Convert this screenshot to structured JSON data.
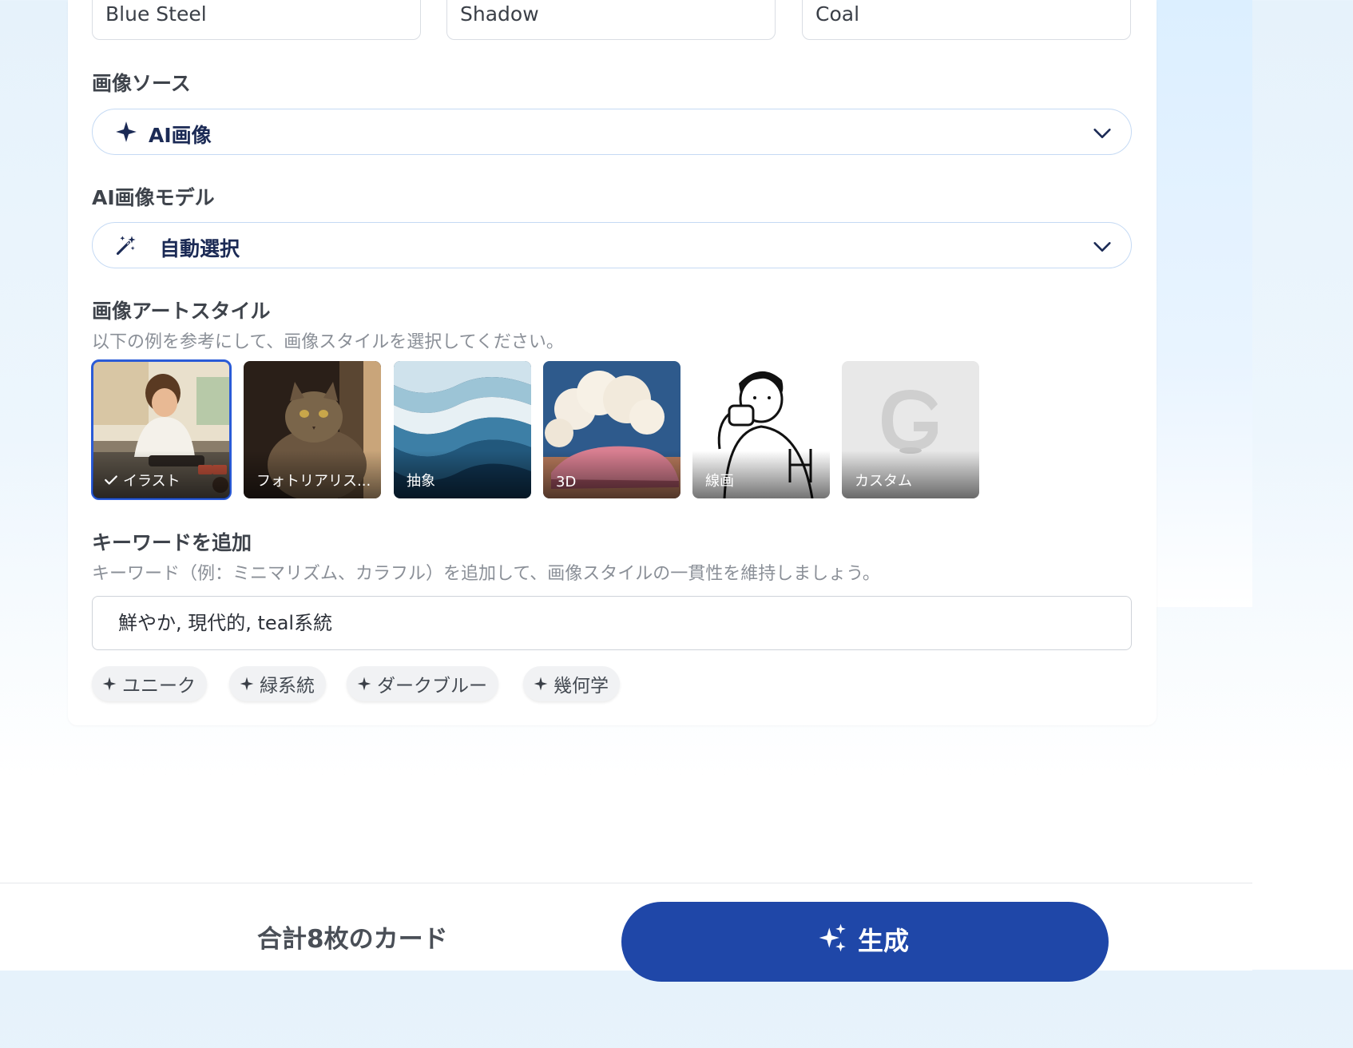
{
  "color_inputs": [
    {
      "value": "Blue Steel"
    },
    {
      "value": "Shadow"
    },
    {
      "value": "Coal"
    }
  ],
  "image_source": {
    "label": "画像ソース",
    "selected": "AI画像",
    "icon": "sparkle-icon"
  },
  "ai_model": {
    "label": "AI画像モデル",
    "selected": "自動選択",
    "icon": "magic-wand-icon"
  },
  "art_style": {
    "label": "画像アートスタイル",
    "description": "以下の例を参考にして、画像スタイルを選択してください。",
    "options": [
      {
        "label": "イラスト",
        "selected": true
      },
      {
        "label": "フォトリアリス...",
        "selected": false
      },
      {
        "label": "抽象",
        "selected": false
      },
      {
        "label": "3D",
        "selected": false
      },
      {
        "label": "線画",
        "selected": false
      },
      {
        "label": "カスタム",
        "selected": false
      }
    ]
  },
  "keywords": {
    "label": "キーワードを追加",
    "description": "キーワード（例：ミニマリズム、カラフル）を追加して、画像スタイルの一貫性を維持しましょう。",
    "value": "鮮やか, 現代的, teal系統",
    "suggestions": [
      "ユニーク",
      "緑系統",
      "ダークブルー",
      "幾何学"
    ]
  },
  "footer": {
    "total": "合計8枚のカード",
    "generate_label": "生成"
  },
  "colors": {
    "accent": "#1f47a8",
    "selected_outline": "#2a5bd7",
    "select_border": "#c5daf4"
  }
}
